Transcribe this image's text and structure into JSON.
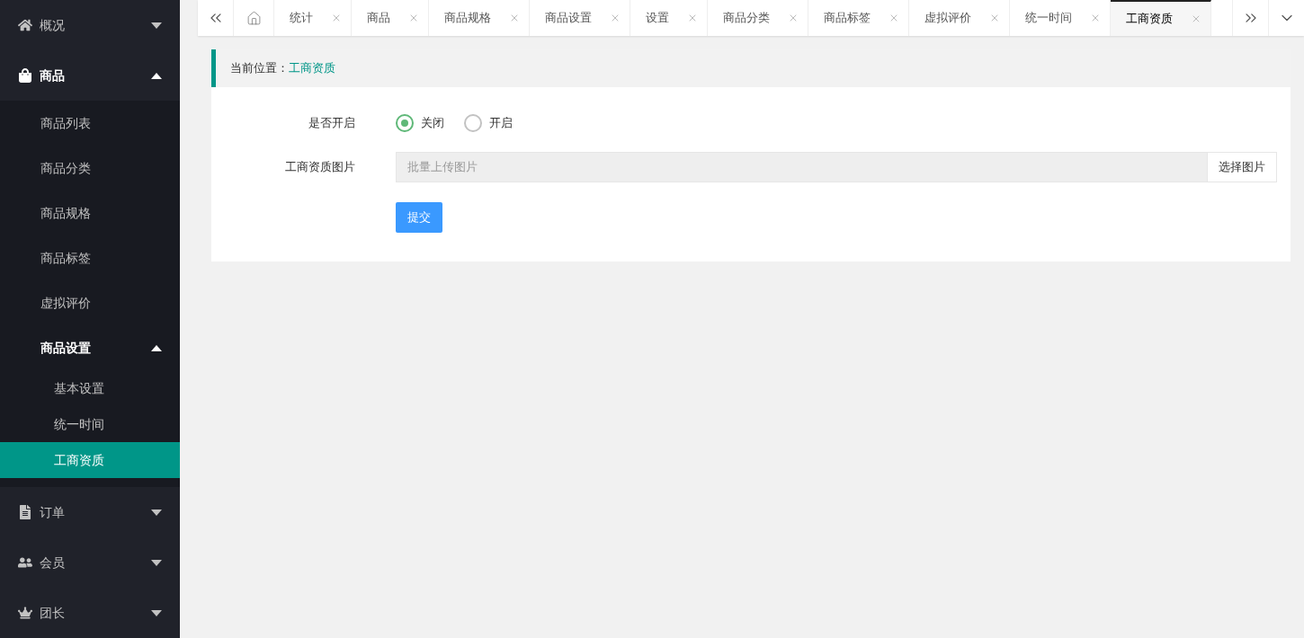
{
  "sidebar": {
    "items": [
      {
        "label": "概况",
        "expanded": false
      },
      {
        "label": "商品",
        "expanded": true,
        "children": [
          {
            "label": "商品列表",
            "selected": false
          },
          {
            "label": "商品分类",
            "selected": false
          },
          {
            "label": "商品规格",
            "selected": false
          },
          {
            "label": "商品标签",
            "selected": false
          },
          {
            "label": "虚拟评价",
            "selected": false
          },
          {
            "label": "商品设置",
            "expanded": true,
            "selected": false,
            "children": [
              {
                "label": "基本设置",
                "selected": false
              },
              {
                "label": "统一时间",
                "selected": false
              },
              {
                "label": "工商资质",
                "selected": true
              }
            ]
          }
        ]
      },
      {
        "label": "订单",
        "expanded": false
      },
      {
        "label": "会员",
        "expanded": false
      },
      {
        "label": "团长",
        "expanded": false
      }
    ]
  },
  "tabs": [
    {
      "label": "统计",
      "selected": false
    },
    {
      "label": "商品",
      "selected": false
    },
    {
      "label": "商品规格",
      "selected": false
    },
    {
      "label": "商品设置",
      "selected": false
    },
    {
      "label": "设置",
      "selected": false
    },
    {
      "label": "商品分类",
      "selected": false
    },
    {
      "label": "商品标签",
      "selected": false
    },
    {
      "label": "虚拟评价",
      "selected": false
    },
    {
      "label": "统一时间",
      "selected": false
    },
    {
      "label": "工商资质",
      "selected": true
    }
  ],
  "breadcrumb": {
    "prefix": "当前位置：",
    "current": "工商资质"
  },
  "form": {
    "enable": {
      "label": "是否开启",
      "options": [
        {
          "label": "关闭",
          "selected": true
        },
        {
          "label": "开启",
          "selected": false
        }
      ]
    },
    "image": {
      "label": "工商资质图片",
      "placeholder": "批量上传图片",
      "button": "选择图片"
    },
    "submit": "提交"
  }
}
